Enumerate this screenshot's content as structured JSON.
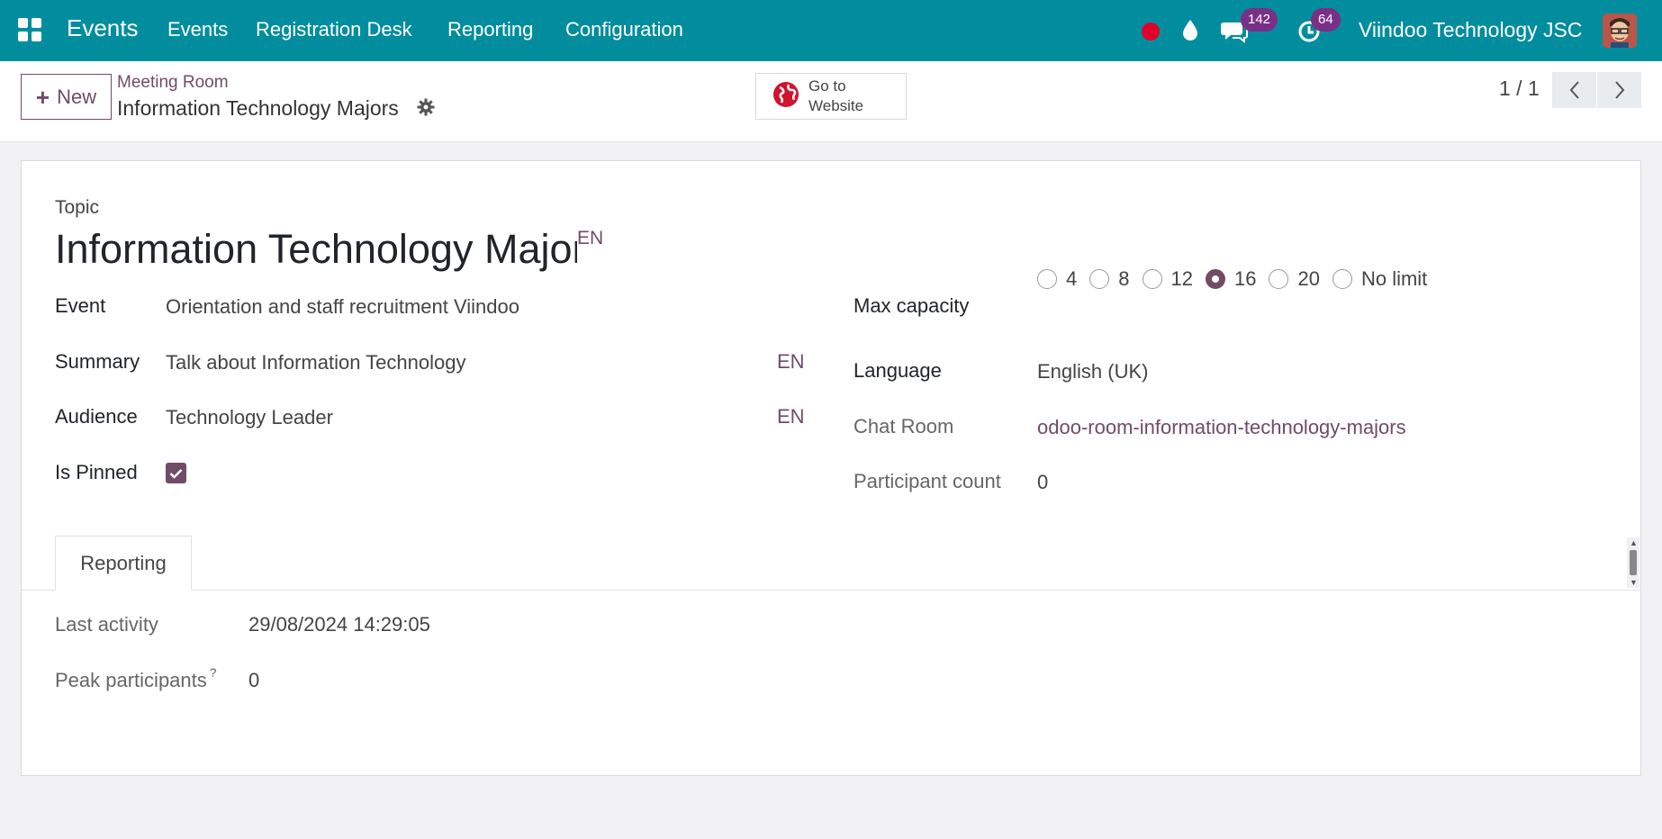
{
  "navbar": {
    "app_name": "Events",
    "menu": [
      "Events",
      "Registration Desk",
      "Reporting",
      "Configuration"
    ],
    "messages_badge": "142",
    "activities_badge": "64",
    "company": "Viindoo Technology JSC",
    "colors": {
      "bar": "#018d9e",
      "badge": "#7a2f86",
      "recording_dot": "#e0002a"
    }
  },
  "control_panel": {
    "new_label": "New",
    "breadcrumb_parent": "Meeting Room",
    "record_name": "Information Technology Majors",
    "website_label": "Go to Website",
    "pager": "1 / 1"
  },
  "form": {
    "topic_label": "Topic",
    "topic_value": "Information Technology Majors",
    "lang_tag": "EN",
    "left_fields": {
      "event_label": "Event",
      "event_value": "Orientation and staff recruitment Viindoo",
      "summary_label": "Summary",
      "summary_value": "Talk about Information Technology",
      "audience_label": "Audience",
      "audience_value": "Technology Leader",
      "pinned_label": "Is Pinned",
      "pinned_checked": true
    },
    "right_fields": {
      "capacity_label": "Max capacity",
      "capacity_options": [
        "4",
        "8",
        "12",
        "16",
        "20",
        "No limit"
      ],
      "capacity_selected": "16",
      "language_label": "Language",
      "language_value": "English (UK)",
      "chat_room_label": "Chat Room",
      "chat_room_value": "odoo-room-information-technology-majors",
      "participant_count_label": "Participant count",
      "participant_count_value": "0"
    },
    "tab_label": "Reporting",
    "reporting": {
      "last_activity_label": "Last activity",
      "last_activity_value": "29/08/2024 14:29:05",
      "peak_label": "Peak participants",
      "peak_help": "?",
      "peak_value": "0"
    },
    "accent_color": "#714b67"
  }
}
